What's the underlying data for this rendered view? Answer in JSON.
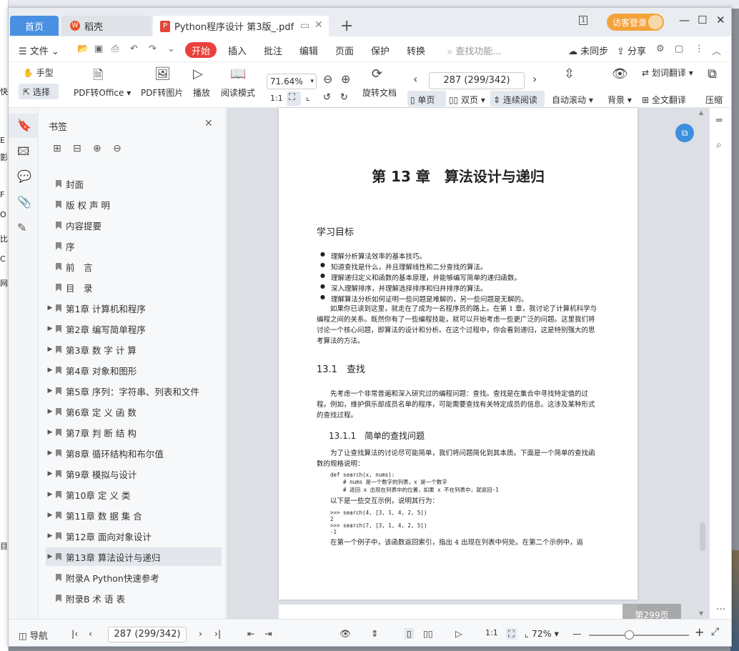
{
  "desktop": {
    "left_chars": [
      "快",
      "E",
      "影",
      "F",
      "O",
      "比",
      "C",
      "网",
      "目"
    ],
    "top_title": "Python程序设计 第3版"
  },
  "tabs": {
    "home": "首页",
    "daoke": "稻壳",
    "document": "Python程序设计 第3版_.pdf",
    "pdf_icon": "P",
    "wps_icon": "W"
  },
  "titlebar": {
    "login": "访客登录",
    "badge": "1"
  },
  "menu": {
    "file": "文件",
    "start": "开始",
    "items": [
      "插入",
      "批注",
      "编辑",
      "页面",
      "保护",
      "转换"
    ],
    "search_placeholder": "查找功能...",
    "sync": "未同步",
    "share": "分享"
  },
  "ribbon": {
    "hand": "手型",
    "select": "选择",
    "pdf_to_office": "PDF转Office",
    "pdf_to_image": "PDF转图片",
    "play": "播放",
    "read_mode": "阅读模式",
    "zoom": "71.64%",
    "rotate_doc": "旋转文档",
    "page_input": "287 (299/342)",
    "single": "单页",
    "double": "双页",
    "continuous": "连续阅读",
    "autoscroll": "自动滚动",
    "background": "背景",
    "translate_word": "划词翻译",
    "translate_full": "全文翻译",
    "compress": "压缩"
  },
  "sidebar": {
    "title": "书签",
    "bookmarks": [
      {
        "label": "封面",
        "expandable": false
      },
      {
        "label": "版 权 声 明",
        "expandable": false
      },
      {
        "label": "内容提要",
        "expandable": false
      },
      {
        "label": "序",
        "expandable": false
      },
      {
        "label": "前　言",
        "expandable": false
      },
      {
        "label": "目　录",
        "expandable": false
      },
      {
        "label": "第1章  计算机和程序",
        "expandable": true
      },
      {
        "label": "第2章  编写简单程序",
        "expandable": true
      },
      {
        "label": "第3章  数 字 计 算",
        "expandable": true
      },
      {
        "label": "第4章  对象和图形",
        "expandable": true
      },
      {
        "label": "第5章  序列：字符串、列表和文件",
        "expandable": true
      },
      {
        "label": "第6章  定 义 函 数",
        "expandable": true
      },
      {
        "label": "第7章  判 断 结 构",
        "expandable": true
      },
      {
        "label": "第8章  循环结构和布尔值",
        "expandable": true
      },
      {
        "label": "第9章  模拟与设计",
        "expandable": true
      },
      {
        "label": "第10章  定 义 类",
        "expandable": true
      },
      {
        "label": "第11章  数 据 集 合",
        "expandable": true
      },
      {
        "label": "第12章  面向对象设计",
        "expandable": true
      },
      {
        "label": "第13章  算法设计与递归",
        "expandable": true,
        "selected": true
      },
      {
        "label": "附录A  Python快速参考",
        "expandable": false
      },
      {
        "label": "附录B  术 语 表",
        "expandable": false
      }
    ]
  },
  "page": {
    "chapter_title": "第 13 章　算法设计与递归",
    "goals_heading": "学习目标",
    "goals": [
      "理解分析算法效率的基本技巧。",
      "知道查找是什么，并且理解线性和二分查找的算法。",
      "理解递归定义和函数的基本原理，并能够编写简单的递归函数。",
      "深入理解排序，并理解选择排序和归并排序的算法。",
      "理解算法分析如何证明一些问题是难解的，另一些问题是无解的。"
    ],
    "intro": "如果你已读到这里，就走在了成为一名程序员的路上。在第 1 章，我讨论了计算机科学与编程之间的关系。既然你有了一些编程技能，就可以开始考虑一些更广泛的问题。这里我们将讨论一个核心问题，即算法的设计和分析。在这个过程中，你会看到递归，这是特别强大的思考算法的方法。",
    "section": "13.1　查找",
    "section_text": "先考虑一个非常普遍和深入研究过的编程问题：查找。查找是在集合中寻找特定值的过程。例如，维护俱乐部成员名单的程序，可能需要查找有关特定成员的信息。这涉及某种形式的查找过程。",
    "subsection": "13.1.1　简单的查找问题",
    "sub_text": "为了让查找算法的讨论尽可能简单，我们将问题简化到其本质。下面是一个简单的查找函数的规格说明：",
    "code1": "def search(x, nums):\n    # nums 是一个数字的列表，x 是一个数字\n    # 返回 x 出现在列表中的位置，如果 x 不在列表中，就返回-1",
    "examples_text": "以下是一些交互示例，说明其行为：",
    "code2": ">>> search(4, [3, 1, 4, 2, 5])\n2\n>>> search(7, [3, 1, 4, 2, 5])\n-1",
    "last_line": "在第一个例子中，该函数返回索引，指出 4 出现在列表中何处。在第二个示例中，返"
  },
  "docview": {
    "page_badge": "第299页"
  },
  "statusbar": {
    "nav": "导航",
    "page_input": "287 (299/342)",
    "zoom": "72%"
  }
}
